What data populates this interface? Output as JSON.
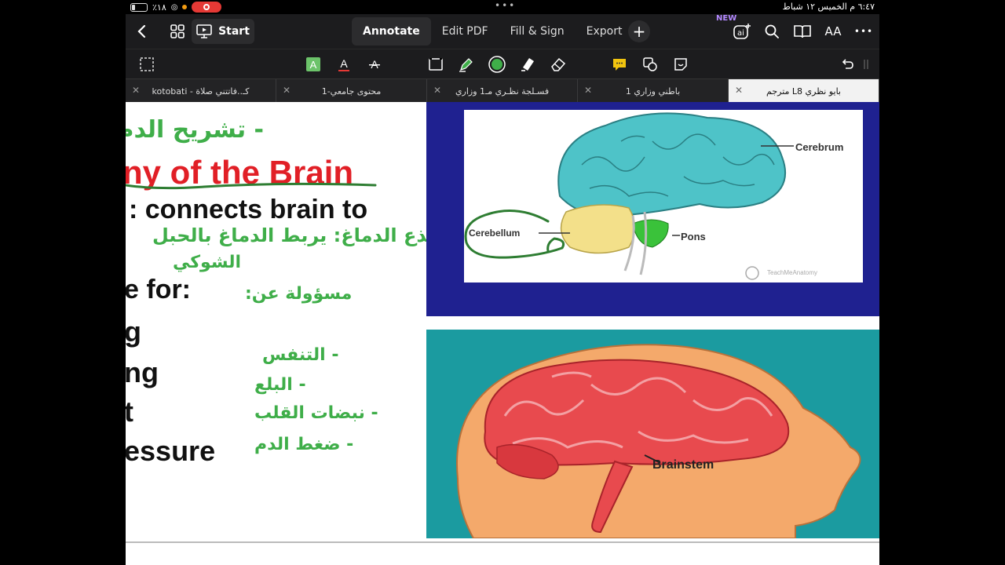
{
  "status_bar": {
    "battery": "٪١٨",
    "datetime": "٦:٤٧ م  الخميس ١٢ شباط",
    "dots": "•••"
  },
  "toolbar": {
    "start_label": "Start",
    "tabs": [
      "Annotate",
      "Edit PDF",
      "Fill & Sign",
      "Export"
    ],
    "active_tab": "Annotate",
    "new_badge": "NEW",
    "ai_label": "ai",
    "text_size_label": "AA",
    "more_label": "•••"
  },
  "annotate_bar": {
    "highlighter_color": "#3fae49",
    "pen_color": "#3fae49"
  },
  "doc_tabs": [
    {
      "label": "كـ..فاتتني صلاة - kotobati",
      "active": false
    },
    {
      "label": "محتوى جامعي-1",
      "active": false
    },
    {
      "label": "فسـلجة نظـري مـ1 وزاري",
      "active": false
    },
    {
      "label": "باطني وزاري 1",
      "active": false
    },
    {
      "label": "بايو نظري L8 مترجم",
      "active": true
    }
  ],
  "page": {
    "ar_title": "- تشريح الدم",
    "en_title": "ny of the Brain",
    "line_connects": ": connects brain to",
    "ar_connects_1": "جذع الدماغ: يربط الدماغ بالحبل",
    "ar_connects_2": "الشوكي",
    "line_responsible": "e for:",
    "ar_responsible": "مسؤولة عن:",
    "en_items": [
      "g",
      "ng",
      "t",
      "essure"
    ],
    "ar_items": [
      "- التنفس",
      "- البلع",
      "- نبضات القلب",
      "- ضغط الدم"
    ],
    "diagram1": {
      "cerebrum": "Cerebrum",
      "cerebellum": "Cerebellum",
      "pons": "Pons",
      "watermark": "TeachMeAnatomy"
    },
    "diagram2": {
      "brainstem": "Brainstem"
    }
  }
}
